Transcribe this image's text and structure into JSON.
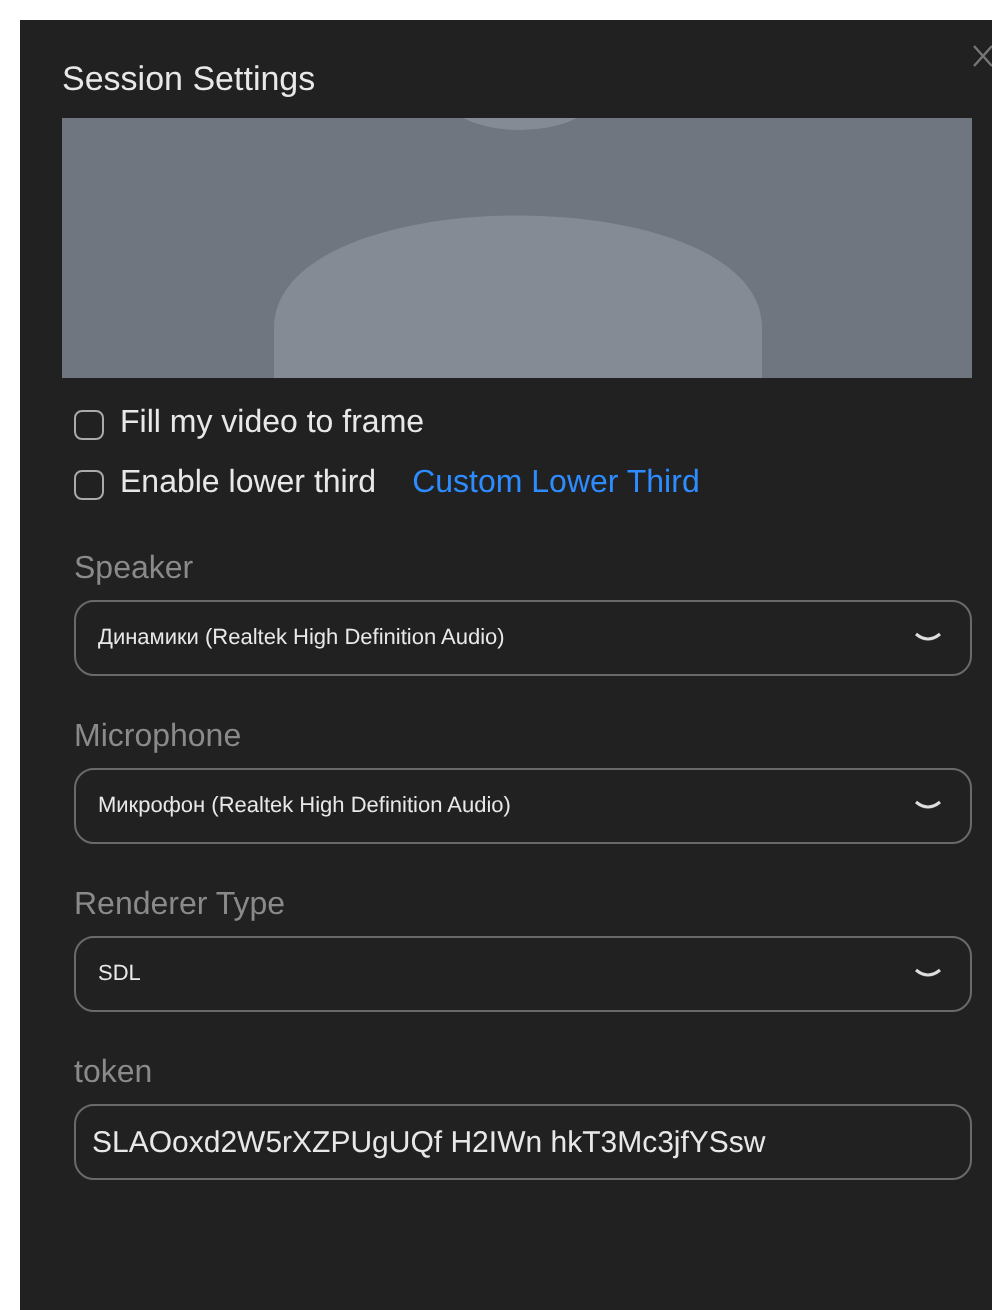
{
  "window": {
    "title": "Session Settings"
  },
  "options": [
    {
      "label": "Fill my video to frame",
      "checked": false
    },
    {
      "label": "Enable lower third",
      "checked": false,
      "link": "Custom Lower Third"
    }
  ],
  "selects": [
    {
      "label": "Speaker",
      "value": "Динамики (Realtek High Definition Audio)"
    },
    {
      "label": "Microphone",
      "value": "Микрофон (Realtek High Definition Audio)"
    },
    {
      "label": "Renderer Type",
      "value": "SDL"
    }
  ],
  "token": {
    "label": "token",
    "value": "SLAOoxd2W5rXZPUgUQf H2IWn hkT3Mc3jfYSsw"
  }
}
